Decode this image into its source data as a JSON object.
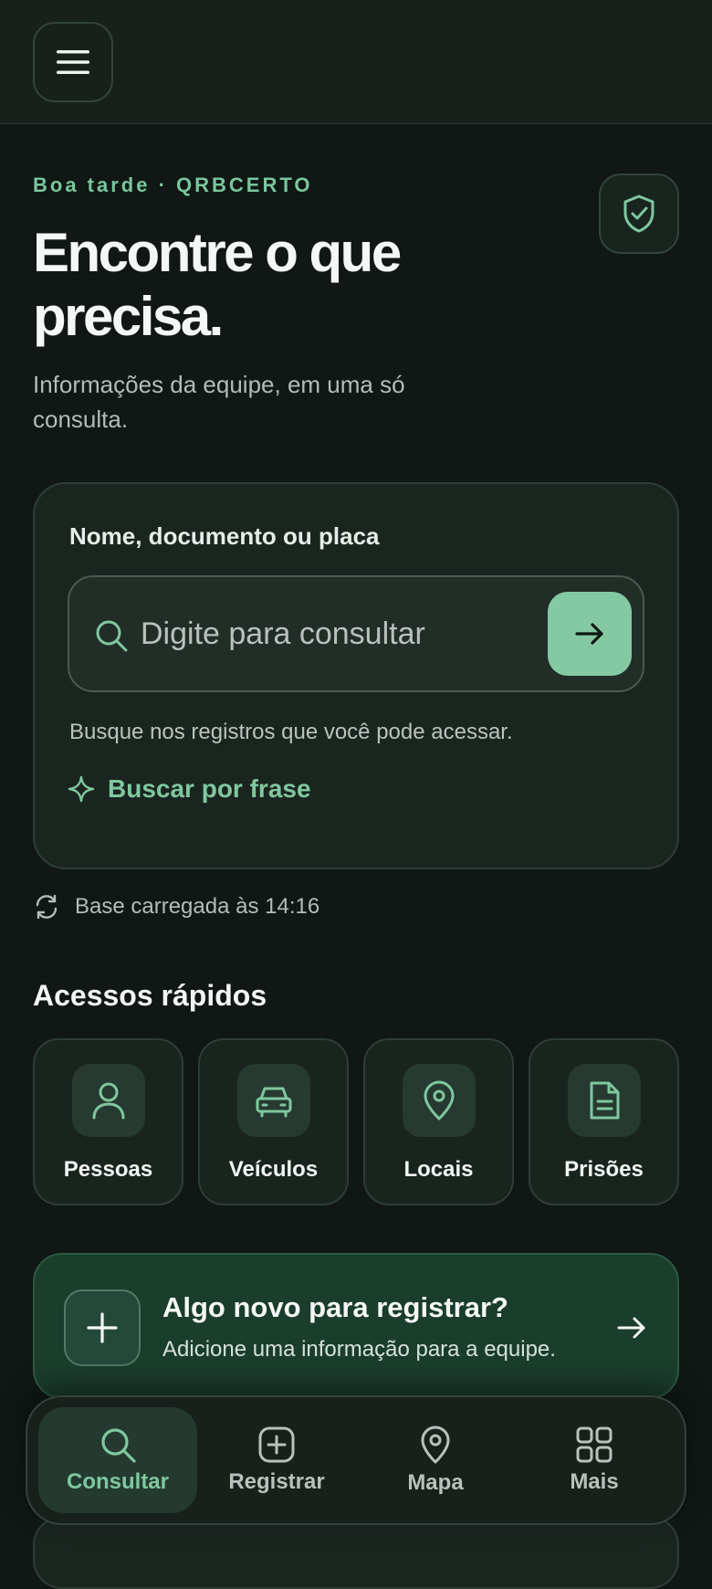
{
  "header": {
    "menu_icon": "hamburger-menu-icon"
  },
  "hero": {
    "greeting": "Boa tarde · QRBCERTO",
    "title": "Encontre o que precisa.",
    "subtitle": "Informações da equipe, em uma só consulta.",
    "shield_icon": "shield-check-icon"
  },
  "search": {
    "label": "Nome, documento ou placa",
    "placeholder": "Digite para consultar",
    "value": "",
    "hint": "Busque nos registros que você pode acessar.",
    "phrase_link": "Buscar por frase"
  },
  "status": {
    "base_loaded": "Base carregada às 14:16"
  },
  "quick_access": {
    "title": "Acessos rápidos",
    "items": [
      {
        "label": "Pessoas",
        "icon": "person-icon"
      },
      {
        "label": "Veículos",
        "icon": "car-icon"
      },
      {
        "label": "Locais",
        "icon": "location-pin-icon"
      },
      {
        "label": "Prisões",
        "icon": "document-icon"
      }
    ]
  },
  "register_card": {
    "title": "Algo novo para registrar?",
    "subtitle": "Adicione uma informação para a equipe."
  },
  "bottom_nav": {
    "items": [
      {
        "label": "Consultar",
        "icon": "search-icon",
        "active": true
      },
      {
        "label": "Registrar",
        "icon": "plus-square-icon",
        "active": false
      },
      {
        "label": "Mapa",
        "icon": "map-pin-icon",
        "active": false
      },
      {
        "label": "Mais",
        "icon": "grid-icon",
        "active": false
      }
    ]
  },
  "colors": {
    "background": "#101715",
    "accent": "#7fc89f",
    "accent_button": "#84c9a2",
    "register_card": "#1a3d2c"
  }
}
